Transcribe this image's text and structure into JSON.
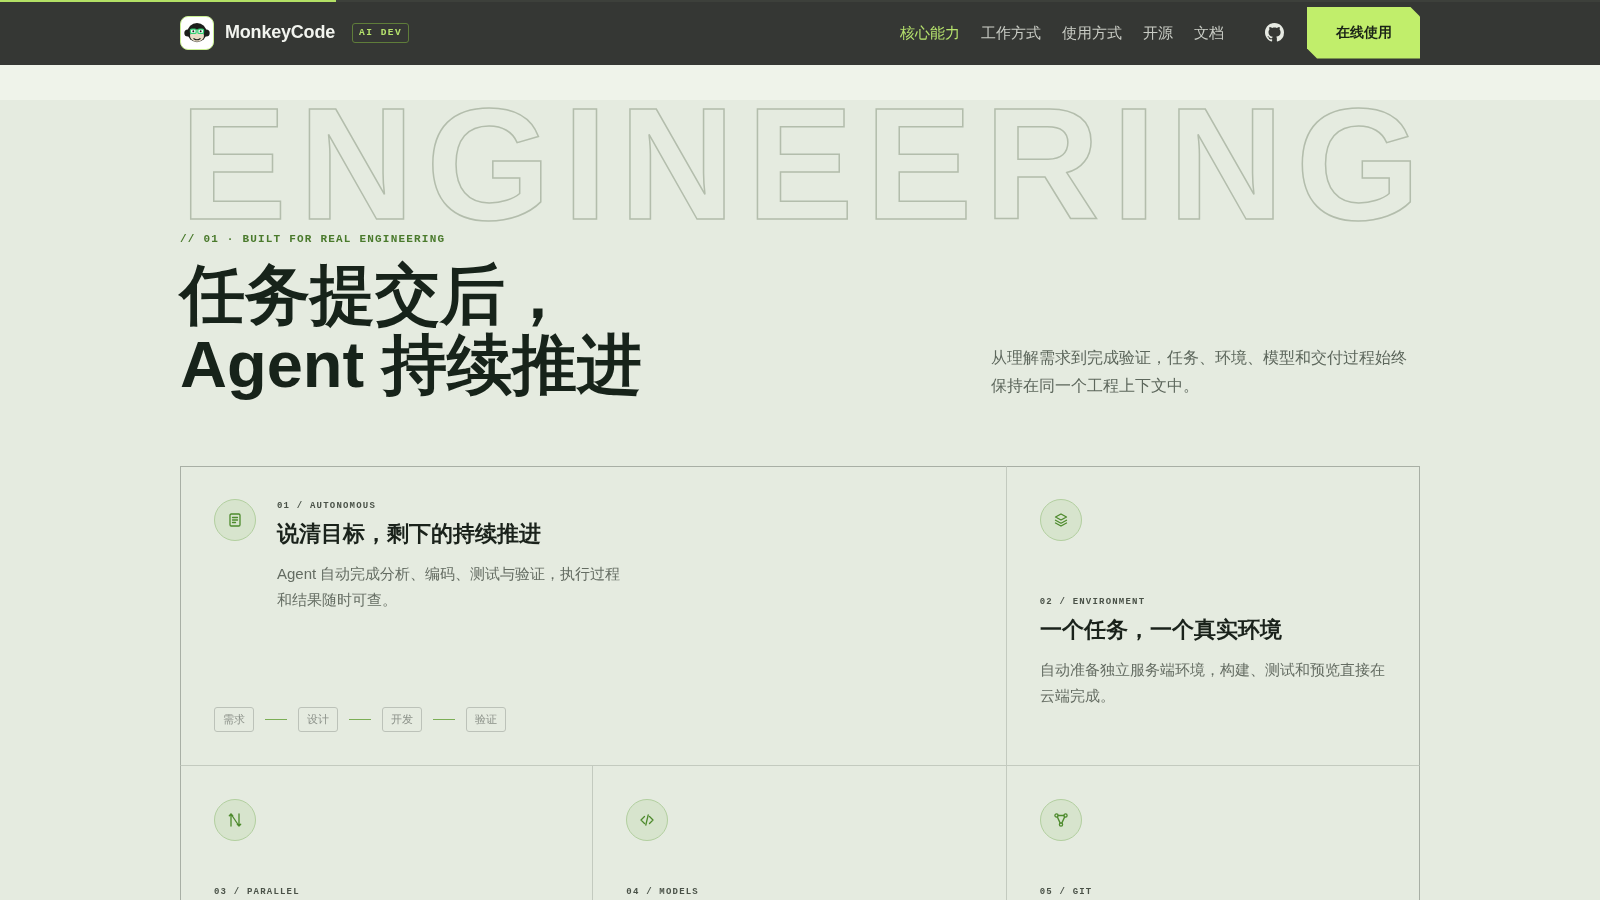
{
  "progress": {
    "level": 0.21
  },
  "header": {
    "brand": "MonkeyCode",
    "badge": "AI DEV",
    "nav": [
      {
        "label": "核心能力",
        "selected": true
      },
      {
        "label": "工作方式",
        "selected": false
      },
      {
        "label": "使用方式",
        "selected": false
      },
      {
        "label": "开源",
        "selected": false
      },
      {
        "label": "文档",
        "selected": false
      }
    ],
    "cta": "在线使用"
  },
  "hero": {
    "watermark": "ENGINEERING",
    "eyebrow": "// 01 · BUILT FOR REAL ENGINEERING",
    "title_lines": [
      "任务提交后，",
      "Agent 持续推进"
    ],
    "description": "从理解需求到完成验证，任务、环境、模型和交付过程始终保持在同一个工程上下文中。"
  },
  "features": [
    {
      "kind": "wide",
      "label": "01 / AUTONOMOUS",
      "title": "说清目标，剩下的持续推进",
      "description": "Agent 自动完成分析、编码、测试与验证，执行过程和结果随时可查。",
      "steps": [
        "需求",
        "设计",
        "开发",
        "验证"
      ]
    },
    {
      "kind": "stacked",
      "label": "02 / ENVIRONMENT",
      "title": "一个任务，一个真实环境",
      "description": "自动准备独立服务端环境，构建、测试和预览直接在云端完成。"
    },
    {
      "kind": "stacked",
      "label": "03 / PARALLEL"
    },
    {
      "kind": "stacked",
      "label": "04 / MODELS"
    },
    {
      "kind": "stacked",
      "label": "05 / GIT"
    }
  ]
}
